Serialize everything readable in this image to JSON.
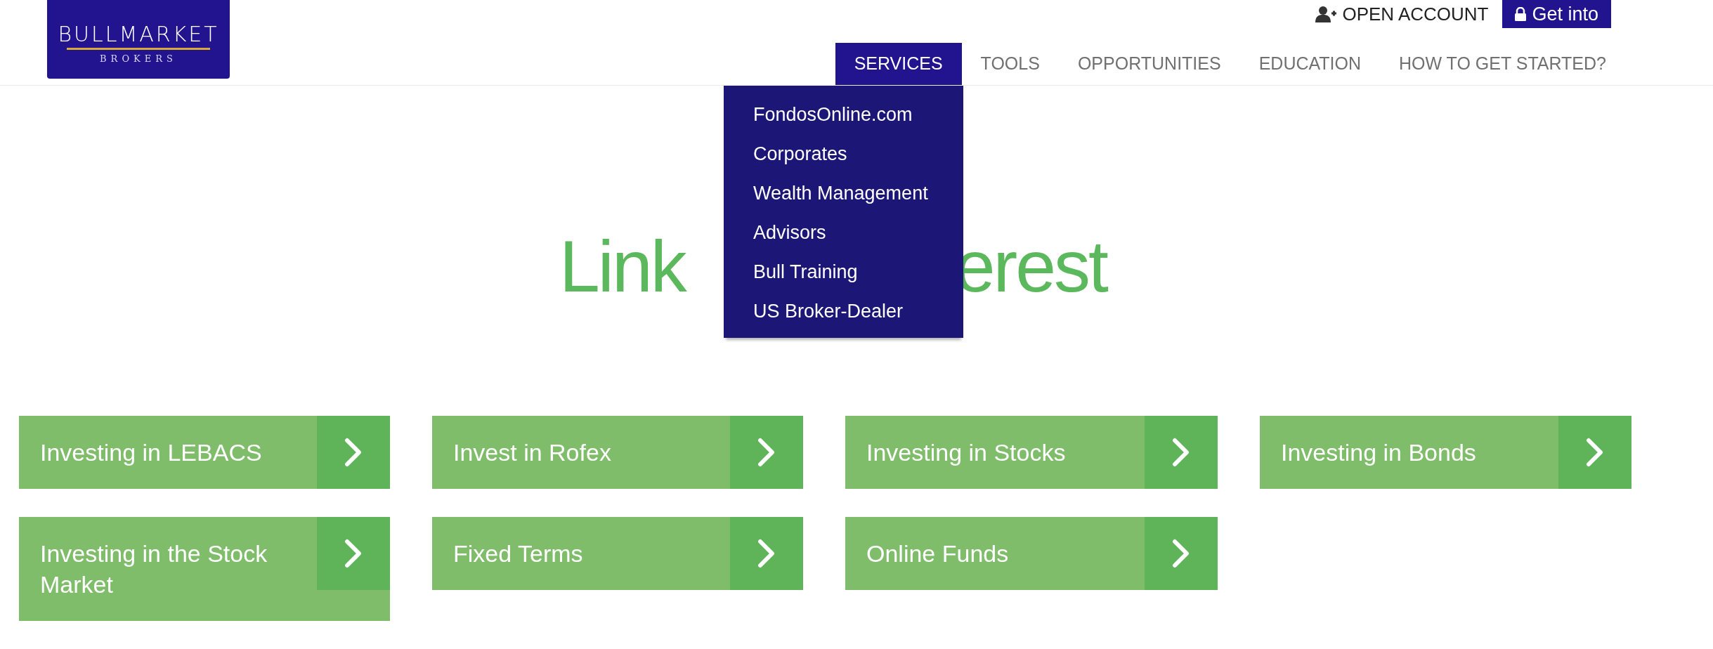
{
  "logo": {
    "name": "BULLMARKET",
    "tagline": "BROKERS"
  },
  "top_links": {
    "open_account": "OPEN ACCOUNT",
    "login_button": "Get into"
  },
  "nav": [
    {
      "label": "SERVICES",
      "selected": true
    },
    {
      "label": "TOOLS",
      "selected": false
    },
    {
      "label": "OPPORTUNITIES",
      "selected": false
    },
    {
      "label": "EDUCATION",
      "selected": false
    },
    {
      "label": "HOW TO GET STARTED?",
      "selected": false
    }
  ],
  "dropdown": [
    "FondosOnline.com",
    "Corporates",
    "Wealth Management",
    "Advisors",
    "Bull Training",
    "US Broker-Dealer"
  ],
  "heading_visible_parts": [
    "Link",
    "erest"
  ],
  "cards": [
    {
      "label": "Investing in LEBACS"
    },
    {
      "label": "Invest in Rofex"
    },
    {
      "label": "Investing in Stocks"
    },
    {
      "label": "Investing in Bonds"
    },
    {
      "label": "Investing in the Stock Market"
    },
    {
      "label": "Fixed Terms"
    },
    {
      "label": "Online Funds"
    }
  ]
}
